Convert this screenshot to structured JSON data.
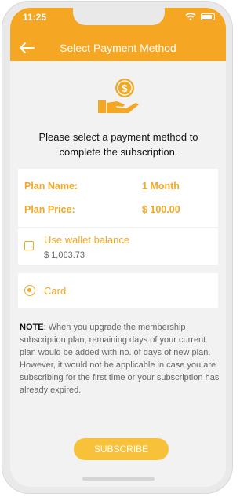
{
  "status": {
    "time": "11:25"
  },
  "header": {
    "title": "Select Payment Method"
  },
  "instruction": "Please select a payment method to complete the subscription.",
  "plan": {
    "name_label": "Plan Name:",
    "name_value": "1 Month",
    "price_label": "Plan Price:",
    "price_value": "$ 100.00"
  },
  "options": {
    "wallet": {
      "label": "Use wallet balance",
      "balance": "$ 1,063.73",
      "checked": false
    },
    "card": {
      "label": "Card",
      "selected": true
    }
  },
  "note": {
    "prefix": "NOTE",
    "text": ": When you upgrade the membership subscription plan, remaining days of your current plan would be added with no. of days of new plan. However, it would not be applicable in case you are subscribing for the first time or your subscription has already expired."
  },
  "subscribe_button": "SUBSCRIBE",
  "colors": {
    "accent": "#f5a623",
    "button": "#f8c13a"
  }
}
